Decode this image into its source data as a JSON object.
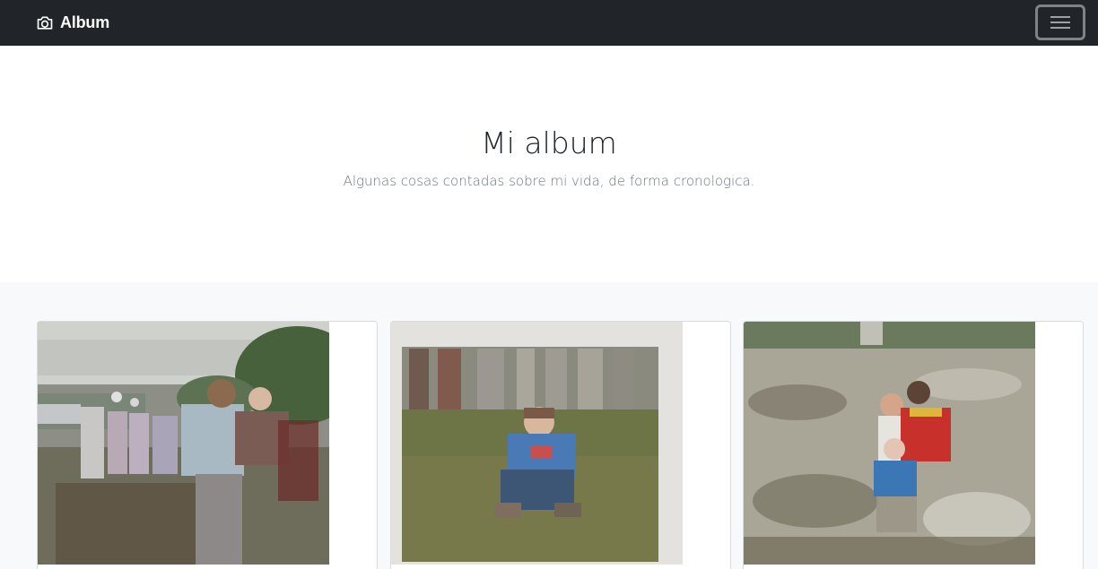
{
  "navbar": {
    "brand": "Album",
    "brand_icon": "camera-icon",
    "toggler_icon": "hamburger-menu-icon"
  },
  "hero": {
    "title": "Mi album",
    "subtitle": "Algunas cosas contadas sobre mi vida, de forma cronologica."
  },
  "colors": {
    "navbar_bg": "#212529",
    "album_bg": "#f8f9fa",
    "text_dark": "#212529",
    "text_muted": "#6c757d"
  },
  "cards": [
    {
      "image": "photo-woman-holding-baby-outdoor-gathering"
    },
    {
      "image": "photo-boy-sitting-on-grass-by-fence"
    },
    {
      "image": "photo-family-standing-in-river"
    }
  ]
}
